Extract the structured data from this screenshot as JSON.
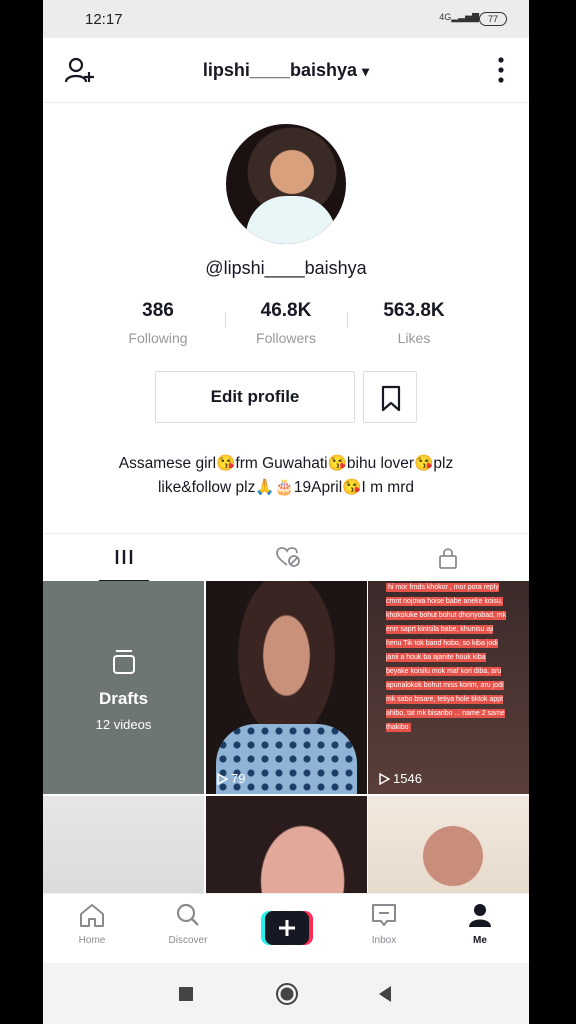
{
  "status": {
    "time": "12:17",
    "signal": "4G",
    "battery": "77"
  },
  "header": {
    "username": "lipshi____baishya",
    "dropdown_glyph": "▾"
  },
  "profile": {
    "handle": "@lipshi____baishya",
    "stats": [
      {
        "value": "386",
        "label": "Following"
      },
      {
        "value": "46.8K",
        "label": "Followers"
      },
      {
        "value": "563.8K",
        "label": "Likes"
      }
    ],
    "edit_label": "Edit profile",
    "bio_line1": "Assamese girl😘frm Guwahati😘bihu lover😘plz",
    "bio_line2": "like&follow plz🙏🎂19April😘I m mrd"
  },
  "grid": {
    "drafts_title": "Drafts",
    "drafts_sub": "12 videos",
    "videos": [
      {
        "plays": "79"
      },
      {
        "plays": "1546"
      }
    ],
    "text_overlay": "hi mor frnds khokor , mor pora reply cmnt nojowa hoise babe aneke koisu, khokoluke bohut bohut dhonyobad, mk enrr saprt kinisila babe, khunisu aji henu Tik tok band hobo, so kiba jodi janii a houk ba ajanite houk kiba beyake koisilu mok maf kori diba, aru apunalokok bohut miss korim, aru jodi mk sabo bisare, tetiya hole tiktok appt ahibo, tat mk bisaribo ... name 2 same thakibo"
  },
  "nav": {
    "home": "Home",
    "discover": "Discover",
    "inbox": "Inbox",
    "me": "Me"
  },
  "colors": {
    "accent_red": "#fe2c55",
    "accent_cyan": "#25f4ee",
    "text": "#161823"
  }
}
